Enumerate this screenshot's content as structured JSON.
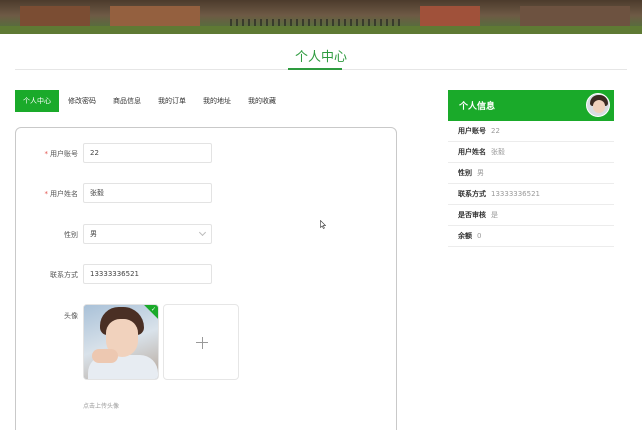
{
  "page": {
    "title": "个人中心"
  },
  "tabs": [
    {
      "label": "个人中心",
      "active": true
    },
    {
      "label": "修改密码",
      "active": false
    },
    {
      "label": "商品信息",
      "active": false
    },
    {
      "label": "我的订单",
      "active": false
    },
    {
      "label": "我的地址",
      "active": false
    },
    {
      "label": "我的收藏",
      "active": false
    }
  ],
  "form": {
    "account": {
      "label": "用户账号",
      "required": true,
      "value": "22"
    },
    "name": {
      "label": "用户姓名",
      "required": true,
      "value": "张毅"
    },
    "gender": {
      "label": "性别",
      "value": "男"
    },
    "phone": {
      "label": "联系方式",
      "value": "13333336521"
    },
    "avatar": {
      "label": "头像",
      "hint": "点击上传头像"
    }
  },
  "info_panel": {
    "title": "个人信息",
    "rows": [
      {
        "key": "用户账号",
        "value": "22"
      },
      {
        "key": "用户姓名",
        "value": "张毅"
      },
      {
        "key": "性别",
        "value": "男"
      },
      {
        "key": "联系方式",
        "value": "13333336521"
      },
      {
        "key": "是否审核",
        "value": "是"
      },
      {
        "key": "余额",
        "value": "0"
      }
    ]
  },
  "colors": {
    "accent": "#1aaa2a",
    "title_green": "#2e9b3f",
    "required": "#e2544e"
  },
  "icons": {
    "upload": "plus-icon",
    "cursor": "mouse-cursor-icon",
    "uploaded_badge": "check-icon"
  }
}
